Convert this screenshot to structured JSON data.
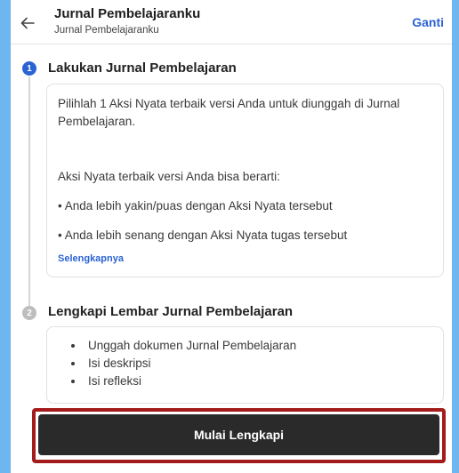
{
  "header": {
    "title": "Jurnal Pembelajaranku",
    "subtitle": "Jurnal Pembelajaranku",
    "action_label": "Ganti",
    "back_icon": "arrow-left-icon"
  },
  "steps": [
    {
      "number": "1",
      "title": "Lakukan Jurnal Pembelajaran",
      "intro": "Pilihlah 1 Aksi Nyata terbaik versi Anda untuk diunggah di Jurnal Pembelajaran.",
      "list_label": "Aksi Nyata terbaik versi Anda bisa berarti:",
      "bullets": [
        "• Anda lebih yakin/puas dengan Aksi Nyata tersebut",
        "• Anda lebih senang dengan Aksi Nyata tugas tersebut"
      ],
      "link_label": "Selengkapnya",
      "status": "active"
    },
    {
      "number": "2",
      "title": "Lengkapi Lembar Jurnal Pembelajaran",
      "items": [
        "Unggah dokumen Jurnal Pembelajaran",
        "Isi deskripsi",
        "Isi refleksi"
      ],
      "status": "inactive"
    }
  ],
  "primary_button": {
    "label": "Mulai Lengkapi"
  },
  "colors": {
    "accent": "#2c63d2",
    "button_bg": "#2a2a2a",
    "highlight_outline": "#a31b1b",
    "inactive_step": "#bdbdbd"
  }
}
